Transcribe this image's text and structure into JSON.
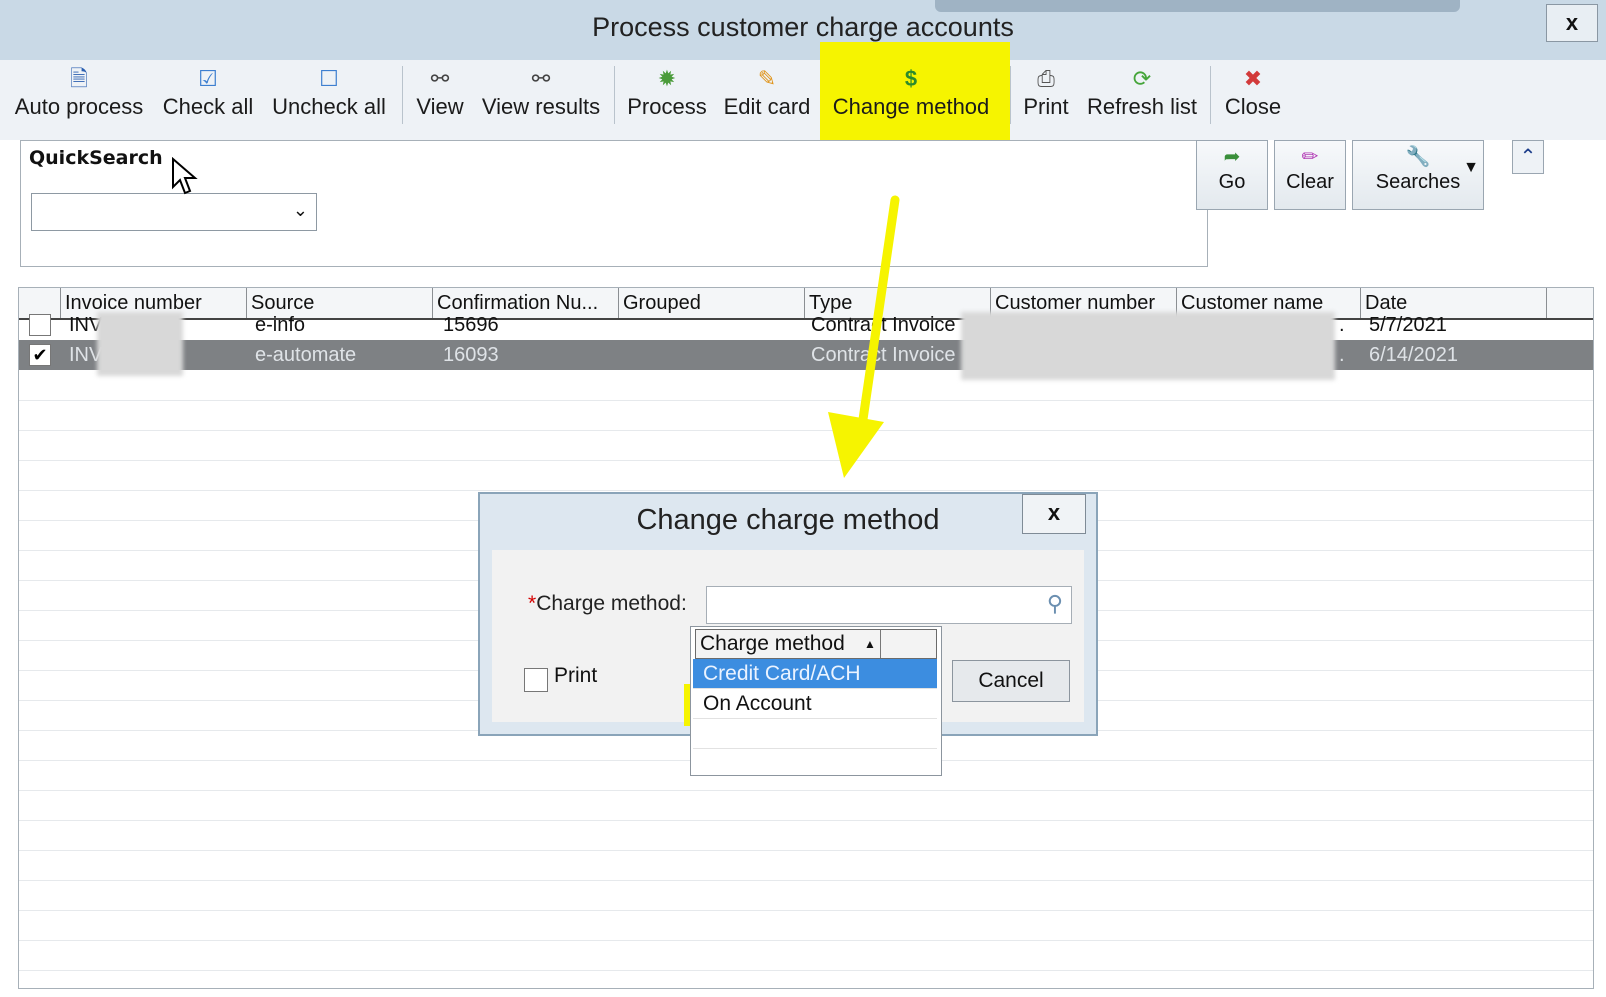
{
  "window": {
    "title": "Process customer charge accounts",
    "close_label": "x"
  },
  "toolbar": {
    "items": [
      {
        "label": "Auto process",
        "icon": "auto-process-icon"
      },
      {
        "label": "Check all",
        "icon": "check-all-icon"
      },
      {
        "label": "Uncheck all",
        "icon": "uncheck-all-icon"
      },
      {
        "label": "View",
        "icon": "binoculars-icon"
      },
      {
        "label": "View results",
        "icon": "binoculars-icon"
      },
      {
        "label": "Process",
        "icon": "process-icon"
      },
      {
        "label": "Edit card",
        "icon": "pencil-icon"
      },
      {
        "label": "Change method",
        "icon": "dollar-icon"
      },
      {
        "label": "Print",
        "icon": "printer-icon"
      },
      {
        "label": "Refresh list",
        "icon": "refresh-icon"
      },
      {
        "label": "Close",
        "icon": "close-icon"
      }
    ]
  },
  "quicksearch": {
    "label": "QuickSearch",
    "value": ""
  },
  "search_buttons": {
    "go": "Go",
    "clear": "Clear",
    "searches": "Searches"
  },
  "grid": {
    "columns": [
      "Invoice number",
      "Source",
      "Confirmation Nu...",
      "Grouped",
      "Type",
      "Customer number",
      "Customer name",
      "Date"
    ],
    "rows": [
      {
        "checked": false,
        "invoice": "INV",
        "source": "e-info",
        "confirmation": "15696",
        "grouped": "",
        "type": "Contract Invoice",
        "customer_number": "",
        "customer_name": ".",
        "date": "5/7/2021"
      },
      {
        "checked": true,
        "invoice": "INV",
        "source": "e-automate",
        "confirmation": "16093",
        "grouped": "",
        "type": "Contract Invoice",
        "customer_number": "",
        "customer_name": ".",
        "date": "6/14/2021"
      }
    ]
  },
  "dialog": {
    "title": "Change charge method",
    "close_label": "x",
    "charge_method_label": "Charge method:",
    "required_mark": "*",
    "charge_method_value": "",
    "print_label": "Print",
    "cancel_label": "Cancel"
  },
  "dropdown": {
    "header": "Charge method",
    "options": [
      "Credit Card/ACH",
      "On Account"
    ],
    "selected_index": 0
  },
  "highlight_color": "#f6f400"
}
